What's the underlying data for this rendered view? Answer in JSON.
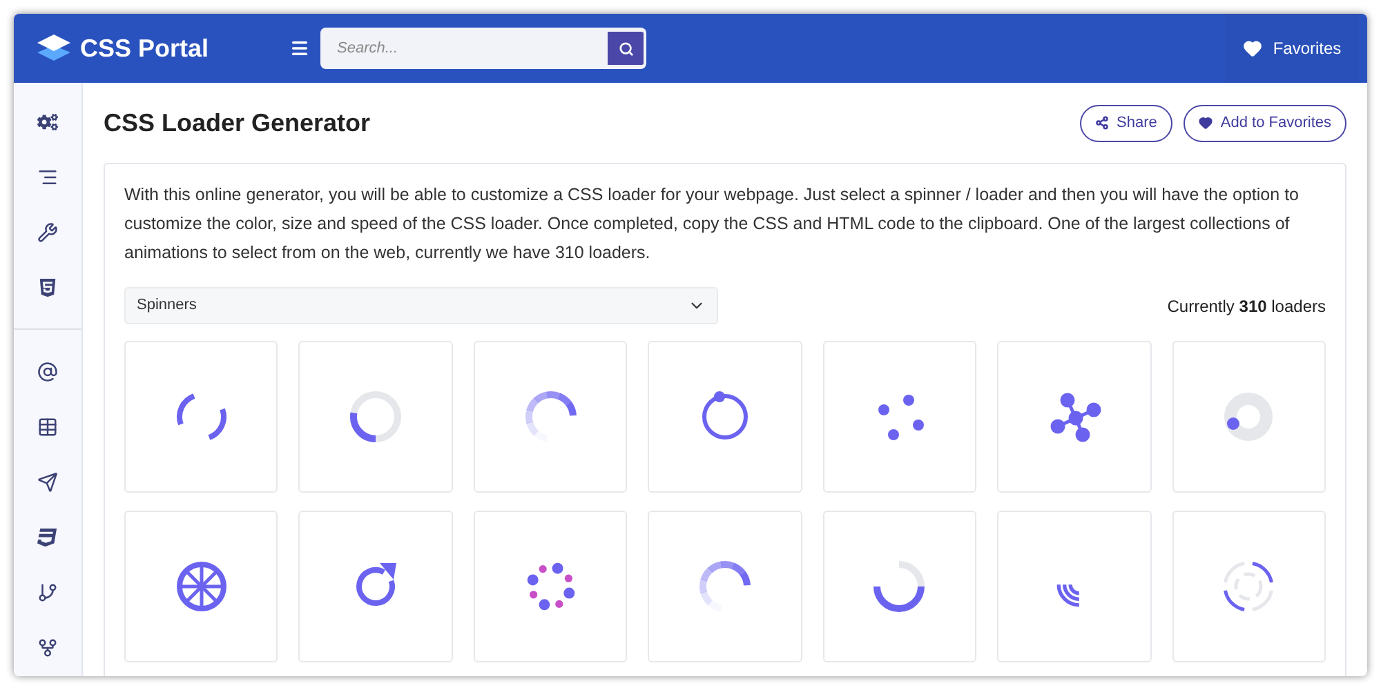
{
  "header": {
    "brand": "CSS Portal",
    "search": {
      "placeholder": "Search..."
    },
    "favorites": "Favorites"
  },
  "page": {
    "title": "CSS Loader Generator",
    "actions": [
      "Share",
      "Add to Favorites"
    ]
  },
  "intro": "With this online generator, you will be able to customize a CSS loader for your webpage. Just select a spinner / loader and then you will have the option to customize the color, size and speed of the CSS loader. Once completed, copy the CSS and HTML code to the clipboard. One of the largest collections of animations to select from on the web, currently we have 310 loaders.",
  "category": {
    "value": "Spinners"
  },
  "count": "Currently **310** loaders",
  "loaders": [
    {
      "kind": "split-arc"
    },
    {
      "kind": "track-arc"
    },
    {
      "kind": "fade-arc"
    },
    {
      "kind": "dot-ring"
    },
    {
      "kind": "dots"
    },
    {
      "kind": "network"
    },
    {
      "kind": "orbit-dot"
    },
    {
      "kind": "wheel"
    },
    {
      "kind": "refresh"
    },
    {
      "kind": "dot-circle"
    },
    {
      "kind": "fade-arc"
    },
    {
      "kind": "half-arc"
    },
    {
      "kind": "waves"
    },
    {
      "kind": "double-ring"
    }
  ]
}
